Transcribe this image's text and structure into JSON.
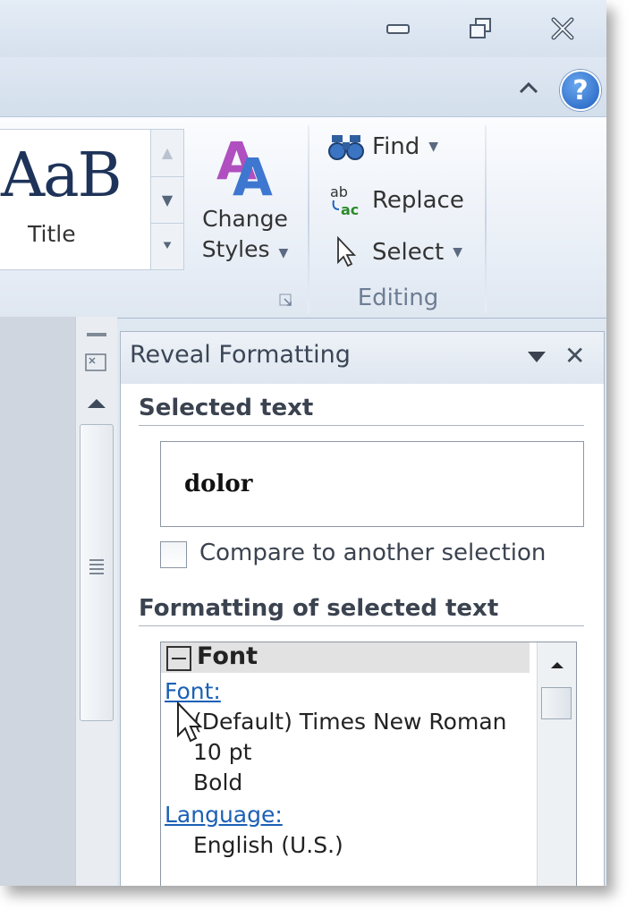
{
  "window_controls": {
    "minimize": "minimize-icon",
    "restore": "restore-icon",
    "close": "close-icon"
  },
  "help": {
    "label": "?"
  },
  "ribbon": {
    "styles_gallery": {
      "preview_text": "AaB",
      "caption": "Title"
    },
    "change_styles": {
      "line1": "Change",
      "line2": "Styles"
    },
    "editing": {
      "find": "Find",
      "replace": "Replace",
      "select": "Select",
      "group_label": "Editing"
    }
  },
  "pane": {
    "title": "Reveal Formatting",
    "selected_text_heading": "Selected text",
    "selected_text_value": "dolor",
    "compare_label": "Compare to another selection",
    "compare_checked": false,
    "formatting_heading": "Formatting of selected text",
    "font_section": {
      "heading": "Font",
      "font_link": "Font:",
      "font_values": [
        "(Default) Times New Roman",
        "10 pt",
        "Bold"
      ],
      "language_link": "Language:",
      "language_value": "English (U.S.)"
    }
  },
  "colors": {
    "link": "#1b60b5",
    "help_button": "#1f5fbf",
    "heading": "#3b4350"
  }
}
